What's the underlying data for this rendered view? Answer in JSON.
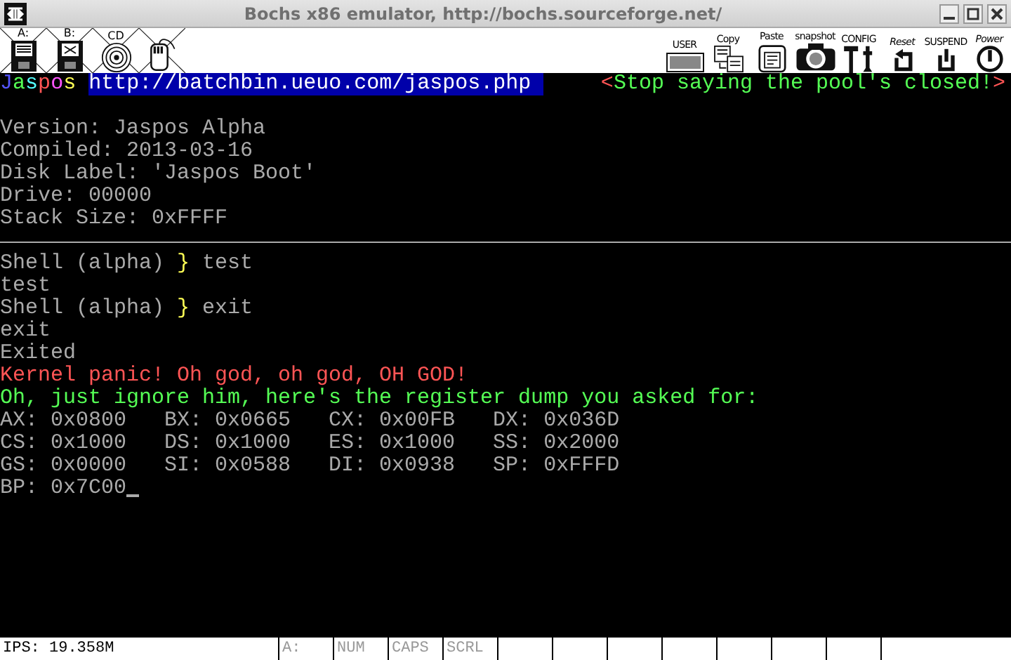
{
  "window": {
    "title": "Bochs x86 emulator, http://bochs.sourceforge.net/"
  },
  "toolbar_left": [
    {
      "kind": "floppy",
      "label": "A:"
    },
    {
      "kind": "floppy2",
      "label": "B:"
    },
    {
      "kind": "cdrom",
      "label": "CD"
    },
    {
      "kind": "mouse"
    }
  ],
  "toolbar_right": [
    {
      "kind": "user",
      "label": "USER"
    },
    {
      "kind": "copy",
      "label": "Copy"
    },
    {
      "kind": "paste",
      "label": "Paste"
    },
    {
      "kind": "snapshot",
      "label": "snapshot"
    },
    {
      "kind": "config",
      "label": "CONFIG"
    },
    {
      "kind": "reset",
      "label": "Reset"
    },
    {
      "kind": "suspend",
      "label": "SUSPEND"
    },
    {
      "kind": "power",
      "label": "Power"
    }
  ],
  "screen": {
    "logo": [
      {
        "text": "J",
        "color": "#5555ff"
      },
      {
        "text": "a",
        "color": "#55ff55"
      },
      {
        "text": "s",
        "color": "#55ffff"
      },
      {
        "text": "p",
        "color": "#ff5555"
      },
      {
        "text": "o",
        "color": "#ff55ff"
      },
      {
        "text": "s",
        "color": "#ffff55"
      }
    ],
    "url": "http://batchbin.ueuo.com/jaspos.php",
    "motto": {
      "open": "<",
      "text": "Stop saying the pool's closed!",
      "close": ">"
    },
    "lines": [
      {
        "kind": "blank"
      },
      {
        "kind": "text",
        "segments": [
          {
            "text": "Version: Jaspos Alpha",
            "color": "#aaaaaa"
          }
        ]
      },
      {
        "kind": "text",
        "segments": [
          {
            "text": "Compiled: 2013-03-16",
            "color": "#aaaaaa"
          }
        ]
      },
      {
        "kind": "text",
        "segments": [
          {
            "text": "Disk Label: 'Jaspos Boot'",
            "color": "#aaaaaa"
          }
        ]
      },
      {
        "kind": "text",
        "segments": [
          {
            "text": "Drive: 00000",
            "color": "#aaaaaa"
          }
        ]
      },
      {
        "kind": "text",
        "segments": [
          {
            "text": "Stack Size: 0xFFFF",
            "color": "#aaaaaa"
          }
        ]
      },
      {
        "kind": "rule"
      },
      {
        "kind": "text",
        "segments": [
          {
            "text": "Shell (alpha) ",
            "color": "#aaaaaa"
          },
          {
            "text": "}",
            "color": "#ffff55"
          },
          {
            "text": " test",
            "color": "#aaaaaa"
          }
        ]
      },
      {
        "kind": "text",
        "segments": [
          {
            "text": "test",
            "color": "#aaaaaa"
          }
        ]
      },
      {
        "kind": "text",
        "segments": [
          {
            "text": "Shell (alpha) ",
            "color": "#aaaaaa"
          },
          {
            "text": "}",
            "color": "#ffff55"
          },
          {
            "text": " exit",
            "color": "#aaaaaa"
          }
        ]
      },
      {
        "kind": "text",
        "segments": [
          {
            "text": "exit",
            "color": "#aaaaaa"
          }
        ]
      },
      {
        "kind": "text",
        "segments": [
          {
            "text": "Exited",
            "color": "#aaaaaa"
          }
        ]
      },
      {
        "kind": "text",
        "segments": [
          {
            "text": "Kernel panic! Oh god, oh god, OH GOD!",
            "color": "#ff5555"
          }
        ]
      },
      {
        "kind": "text",
        "segments": [
          {
            "text": "Oh, just ignore him, here's the register dump you asked for:",
            "color": "#55ff55"
          }
        ]
      },
      {
        "kind": "text",
        "segments": [
          {
            "text": "AX: 0x0800   BX: 0x0665   CX: 0x00FB   DX: 0x036D",
            "color": "#aaaaaa"
          }
        ]
      },
      {
        "kind": "text",
        "segments": [
          {
            "text": "CS: 0x1000   DS: 0x1000   ES: 0x1000   SS: 0x2000",
            "color": "#aaaaaa"
          }
        ]
      },
      {
        "kind": "text",
        "segments": [
          {
            "text": "GS: 0x0000   SI: 0x0588   DI: 0x0938   SP: 0xFFFD",
            "color": "#aaaaaa"
          }
        ]
      },
      {
        "kind": "text",
        "segments": [
          {
            "text": "BP: 0x7C00",
            "color": "#aaaaaa"
          }
        ],
        "cursor": true
      }
    ]
  },
  "status_bar": {
    "ips": "IPS: 19.358M",
    "indicators": [
      {
        "label": "A:",
        "on": false
      },
      {
        "label": "NUM",
        "on": false
      },
      {
        "label": "CAPS",
        "on": false
      },
      {
        "label": "SCRL",
        "on": false
      }
    ]
  }
}
